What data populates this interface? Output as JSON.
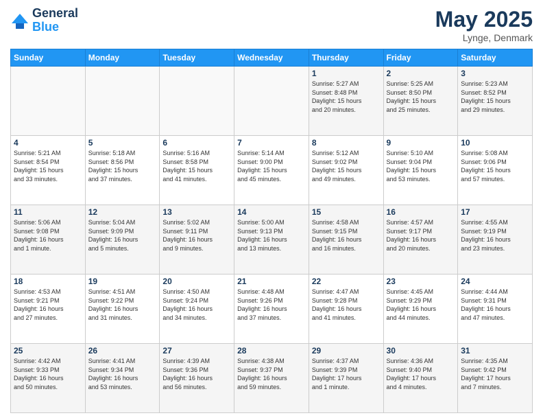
{
  "header": {
    "logo_line1": "General",
    "logo_line2": "Blue",
    "month": "May 2025",
    "location": "Lynge, Denmark"
  },
  "weekdays": [
    "Sunday",
    "Monday",
    "Tuesday",
    "Wednesday",
    "Thursday",
    "Friday",
    "Saturday"
  ],
  "weeks": [
    [
      {
        "day": "",
        "info": ""
      },
      {
        "day": "",
        "info": ""
      },
      {
        "day": "",
        "info": ""
      },
      {
        "day": "",
        "info": ""
      },
      {
        "day": "1",
        "info": "Sunrise: 5:27 AM\nSunset: 8:48 PM\nDaylight: 15 hours\nand 20 minutes."
      },
      {
        "day": "2",
        "info": "Sunrise: 5:25 AM\nSunset: 8:50 PM\nDaylight: 15 hours\nand 25 minutes."
      },
      {
        "day": "3",
        "info": "Sunrise: 5:23 AM\nSunset: 8:52 PM\nDaylight: 15 hours\nand 29 minutes."
      }
    ],
    [
      {
        "day": "4",
        "info": "Sunrise: 5:21 AM\nSunset: 8:54 PM\nDaylight: 15 hours\nand 33 minutes."
      },
      {
        "day": "5",
        "info": "Sunrise: 5:18 AM\nSunset: 8:56 PM\nDaylight: 15 hours\nand 37 minutes."
      },
      {
        "day": "6",
        "info": "Sunrise: 5:16 AM\nSunset: 8:58 PM\nDaylight: 15 hours\nand 41 minutes."
      },
      {
        "day": "7",
        "info": "Sunrise: 5:14 AM\nSunset: 9:00 PM\nDaylight: 15 hours\nand 45 minutes."
      },
      {
        "day": "8",
        "info": "Sunrise: 5:12 AM\nSunset: 9:02 PM\nDaylight: 15 hours\nand 49 minutes."
      },
      {
        "day": "9",
        "info": "Sunrise: 5:10 AM\nSunset: 9:04 PM\nDaylight: 15 hours\nand 53 minutes."
      },
      {
        "day": "10",
        "info": "Sunrise: 5:08 AM\nSunset: 9:06 PM\nDaylight: 15 hours\nand 57 minutes."
      }
    ],
    [
      {
        "day": "11",
        "info": "Sunrise: 5:06 AM\nSunset: 9:08 PM\nDaylight: 16 hours\nand 1 minute."
      },
      {
        "day": "12",
        "info": "Sunrise: 5:04 AM\nSunset: 9:09 PM\nDaylight: 16 hours\nand 5 minutes."
      },
      {
        "day": "13",
        "info": "Sunrise: 5:02 AM\nSunset: 9:11 PM\nDaylight: 16 hours\nand 9 minutes."
      },
      {
        "day": "14",
        "info": "Sunrise: 5:00 AM\nSunset: 9:13 PM\nDaylight: 16 hours\nand 13 minutes."
      },
      {
        "day": "15",
        "info": "Sunrise: 4:58 AM\nSunset: 9:15 PM\nDaylight: 16 hours\nand 16 minutes."
      },
      {
        "day": "16",
        "info": "Sunrise: 4:57 AM\nSunset: 9:17 PM\nDaylight: 16 hours\nand 20 minutes."
      },
      {
        "day": "17",
        "info": "Sunrise: 4:55 AM\nSunset: 9:19 PM\nDaylight: 16 hours\nand 23 minutes."
      }
    ],
    [
      {
        "day": "18",
        "info": "Sunrise: 4:53 AM\nSunset: 9:21 PM\nDaylight: 16 hours\nand 27 minutes."
      },
      {
        "day": "19",
        "info": "Sunrise: 4:51 AM\nSunset: 9:22 PM\nDaylight: 16 hours\nand 31 minutes."
      },
      {
        "day": "20",
        "info": "Sunrise: 4:50 AM\nSunset: 9:24 PM\nDaylight: 16 hours\nand 34 minutes."
      },
      {
        "day": "21",
        "info": "Sunrise: 4:48 AM\nSunset: 9:26 PM\nDaylight: 16 hours\nand 37 minutes."
      },
      {
        "day": "22",
        "info": "Sunrise: 4:47 AM\nSunset: 9:28 PM\nDaylight: 16 hours\nand 41 minutes."
      },
      {
        "day": "23",
        "info": "Sunrise: 4:45 AM\nSunset: 9:29 PM\nDaylight: 16 hours\nand 44 minutes."
      },
      {
        "day": "24",
        "info": "Sunrise: 4:44 AM\nSunset: 9:31 PM\nDaylight: 16 hours\nand 47 minutes."
      }
    ],
    [
      {
        "day": "25",
        "info": "Sunrise: 4:42 AM\nSunset: 9:33 PM\nDaylight: 16 hours\nand 50 minutes."
      },
      {
        "day": "26",
        "info": "Sunrise: 4:41 AM\nSunset: 9:34 PM\nDaylight: 16 hours\nand 53 minutes."
      },
      {
        "day": "27",
        "info": "Sunrise: 4:39 AM\nSunset: 9:36 PM\nDaylight: 16 hours\nand 56 minutes."
      },
      {
        "day": "28",
        "info": "Sunrise: 4:38 AM\nSunset: 9:37 PM\nDaylight: 16 hours\nand 59 minutes."
      },
      {
        "day": "29",
        "info": "Sunrise: 4:37 AM\nSunset: 9:39 PM\nDaylight: 17 hours\nand 1 minute."
      },
      {
        "day": "30",
        "info": "Sunrise: 4:36 AM\nSunset: 9:40 PM\nDaylight: 17 hours\nand 4 minutes."
      },
      {
        "day": "31",
        "info": "Sunrise: 4:35 AM\nSunset: 9:42 PM\nDaylight: 17 hours\nand 7 minutes."
      }
    ]
  ]
}
